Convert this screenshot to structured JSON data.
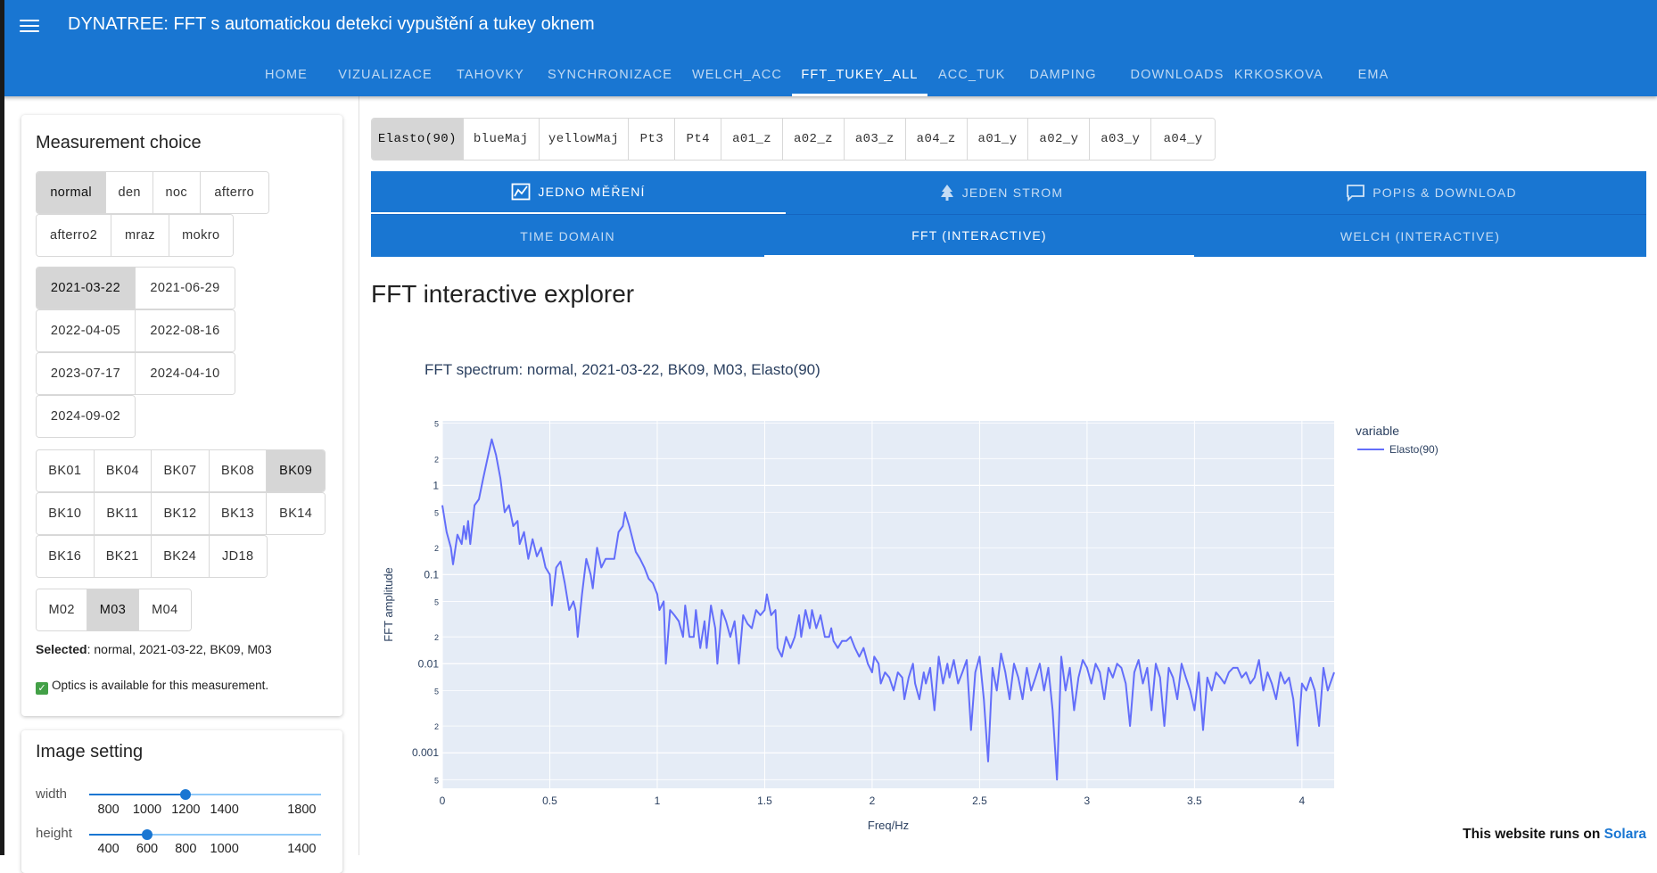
{
  "app_bar": {
    "title": "DYNATREE: FFT s automatickou detekci vypuštění a tukey oknem",
    "nav": [
      {
        "label": "HOME"
      },
      {
        "label": "VIZUALIZACE"
      },
      {
        "label": "TAHOVKY"
      },
      {
        "label": "SYNCHRONIZACE"
      },
      {
        "label": "WELCH_ACC"
      },
      {
        "label": "FFT_TUKEY_ALL",
        "active": true
      },
      {
        "label": "ACC_TUK"
      },
      {
        "label": "DAMPING"
      },
      {
        "label": "DOWNLOADS"
      },
      {
        "label": "KRKOSKOVA"
      },
      {
        "label": "EMA"
      }
    ]
  },
  "sidebar": {
    "measurement_title": "Measurement choice",
    "day_types": [
      {
        "label": "normal",
        "selected": true
      },
      {
        "label": "den"
      },
      {
        "label": "noc"
      },
      {
        "label": "afterro"
      },
      {
        "label": "afterro2"
      },
      {
        "label": "mraz"
      },
      {
        "label": "mokro"
      }
    ],
    "dates": [
      {
        "label": "2021-03-22",
        "selected": true
      },
      {
        "label": "2021-06-29"
      },
      {
        "label": "2022-04-05"
      },
      {
        "label": "2022-08-16"
      },
      {
        "label": "2023-07-17"
      },
      {
        "label": "2024-04-10"
      },
      {
        "label": "2024-09-02"
      }
    ],
    "trees": [
      {
        "label": "BK01"
      },
      {
        "label": "BK04"
      },
      {
        "label": "BK07"
      },
      {
        "label": "BK08"
      },
      {
        "label": "BK09",
        "selected": true
      },
      {
        "label": "BK10"
      },
      {
        "label": "BK11"
      },
      {
        "label": "BK12"
      },
      {
        "label": "BK13"
      },
      {
        "label": "BK14"
      },
      {
        "label": "BK16"
      },
      {
        "label": "BK21"
      },
      {
        "label": "BK24"
      },
      {
        "label": "JD18"
      }
    ],
    "measurements": [
      {
        "label": "M02"
      },
      {
        "label": "M03",
        "selected": true
      },
      {
        "label": "M04"
      }
    ],
    "selected_label": "Selected",
    "selected_value": ": normal, 2021-03-22, BK09, M03",
    "optics_text": "Optics is available for this measurement.",
    "image_title": "Image setting",
    "width": {
      "label": "width",
      "value": 1200,
      "min": 700,
      "max": 1900,
      "ticks": [
        "800",
        "1000",
        "1200",
        "1400",
        "1800"
      ]
    },
    "height": {
      "label": "height",
      "value": 600,
      "min": 300,
      "max": 1500,
      "ticks": [
        "400",
        "600",
        "800",
        "1000",
        "1400"
      ]
    }
  },
  "probes": [
    {
      "label": "Elasto(90)",
      "selected": true
    },
    {
      "label": "blueMaj"
    },
    {
      "label": "yellowMaj"
    },
    {
      "label": "Pt3"
    },
    {
      "label": "Pt4"
    },
    {
      "label": "a01_z"
    },
    {
      "label": "a02_z"
    },
    {
      "label": "a03_z"
    },
    {
      "label": "a04_z"
    },
    {
      "label": "a01_y"
    },
    {
      "label": "a02_y"
    },
    {
      "label": "a03_y"
    },
    {
      "label": "a04_y"
    }
  ],
  "main_tabs": [
    {
      "label": "JEDNO MĚŘENÍ",
      "icon": "chart-line-icon",
      "active": true
    },
    {
      "label": "JEDEN STROM",
      "icon": "tree-icon"
    },
    {
      "label": "POPIS & DOWNLOAD",
      "icon": "comment-icon"
    }
  ],
  "sub_tabs": [
    {
      "label": "TIME DOMAIN"
    },
    {
      "label": "FFT (INTERACTIVE)",
      "active": true
    },
    {
      "label": "WELCH (INTERACTIVE)"
    }
  ],
  "content": {
    "heading": "FFT interactive explorer"
  },
  "chart_data": {
    "type": "line",
    "title": "FFT spectrum: normal, 2021-03-22, BK09, M03, Elasto(90)",
    "xlabel": "Freq/Hz",
    "ylabel": "FFT amplitude",
    "xlim": [
      0,
      4.15
    ],
    "ylim": [
      0.0004,
      5.3
    ],
    "yscale": "log",
    "grid": true,
    "legend_title": "variable",
    "legend_position": "right",
    "x_ticks": [
      "0",
      "0.5",
      "1",
      "1.5",
      "2",
      "2.5",
      "3",
      "3.5",
      "4"
    ],
    "y_tick_labels": [
      {
        "v": 5,
        "t": "5"
      },
      {
        "v": 2,
        "t": "2"
      },
      {
        "v": 1,
        "t": "1"
      },
      {
        "v": 0.5,
        "t": "5"
      },
      {
        "v": 0.2,
        "t": "2"
      },
      {
        "v": 0.1,
        "t": "0.1"
      },
      {
        "v": 0.05,
        "t": "5"
      },
      {
        "v": 0.02,
        "t": "2"
      },
      {
        "v": 0.01,
        "t": "0.01"
      },
      {
        "v": 0.005,
        "t": "5"
      },
      {
        "v": 0.002,
        "t": "2"
      },
      {
        "v": 0.001,
        "t": "0.001"
      },
      {
        "v": 0.0005,
        "t": "5"
      }
    ],
    "series": [
      {
        "name": "Elasto(90)",
        "color": "#636efa",
        "points": [
          [
            0,
            0.6
          ],
          [
            0.02,
            0.3
          ],
          [
            0.04,
            0.2
          ],
          [
            0.05,
            0.13
          ],
          [
            0.07,
            0.28
          ],
          [
            0.09,
            0.22
          ],
          [
            0.1,
            0.35
          ],
          [
            0.11,
            0.25
          ],
          [
            0.12,
            0.4
          ],
          [
            0.13,
            0.22
          ],
          [
            0.15,
            0.6
          ],
          [
            0.17,
            0.7
          ],
          [
            0.19,
            1.2
          ],
          [
            0.21,
            2.0
          ],
          [
            0.23,
            3.3
          ],
          [
            0.25,
            2.2
          ],
          [
            0.27,
            1.2
          ],
          [
            0.29,
            0.5
          ],
          [
            0.31,
            0.6
          ],
          [
            0.33,
            0.35
          ],
          [
            0.35,
            0.4
          ],
          [
            0.36,
            0.22
          ],
          [
            0.38,
            0.3
          ],
          [
            0.4,
            0.15
          ],
          [
            0.42,
            0.25
          ],
          [
            0.44,
            0.16
          ],
          [
            0.46,
            0.2
          ],
          [
            0.48,
            0.12
          ],
          [
            0.5,
            0.1
          ],
          [
            0.51,
            0.045
          ],
          [
            0.53,
            0.12
          ],
          [
            0.55,
            0.14
          ],
          [
            0.57,
            0.08
          ],
          [
            0.59,
            0.04
          ],
          [
            0.61,
            0.05
          ],
          [
            0.62,
            0.04
          ],
          [
            0.63,
            0.02
          ],
          [
            0.65,
            0.06
          ],
          [
            0.67,
            0.15
          ],
          [
            0.69,
            0.1
          ],
          [
            0.7,
            0.07
          ],
          [
            0.72,
            0.2
          ],
          [
            0.74,
            0.12
          ],
          [
            0.76,
            0.15
          ],
          [
            0.78,
            0.15
          ],
          [
            0.8,
            0.15
          ],
          [
            0.82,
            0.3
          ],
          [
            0.84,
            0.35
          ],
          [
            0.85,
            0.5
          ],
          [
            0.87,
            0.35
          ],
          [
            0.9,
            0.18
          ],
          [
            0.92,
            0.15
          ],
          [
            0.94,
            0.12
          ],
          [
            0.96,
            0.09
          ],
          [
            0.98,
            0.08
          ],
          [
            1.0,
            0.06
          ],
          [
            1.01,
            0.04
          ],
          [
            1.03,
            0.05
          ],
          [
            1.04,
            0.01
          ],
          [
            1.06,
            0.04
          ],
          [
            1.08,
            0.035
          ],
          [
            1.1,
            0.03
          ],
          [
            1.12,
            0.02
          ],
          [
            1.13,
            0.045
          ],
          [
            1.15,
            0.02
          ],
          [
            1.17,
            0.02
          ],
          [
            1.18,
            0.04
          ],
          [
            1.2,
            0.015
          ],
          [
            1.22,
            0.03
          ],
          [
            1.23,
            0.015
          ],
          [
            1.25,
            0.045
          ],
          [
            1.27,
            0.025
          ],
          [
            1.28,
            0.01
          ],
          [
            1.3,
            0.04
          ],
          [
            1.32,
            0.03
          ],
          [
            1.34,
            0.02
          ],
          [
            1.36,
            0.03
          ],
          [
            1.38,
            0.01
          ],
          [
            1.4,
            0.035
          ],
          [
            1.42,
            0.028
          ],
          [
            1.44,
            0.025
          ],
          [
            1.46,
            0.04
          ],
          [
            1.48,
            0.035
          ],
          [
            1.5,
            0.04
          ],
          [
            1.51,
            0.06
          ],
          [
            1.53,
            0.035
          ],
          [
            1.55,
            0.04
          ],
          [
            1.56,
            0.015
          ],
          [
            1.58,
            0.012
          ],
          [
            1.6,
            0.02
          ],
          [
            1.62,
            0.015
          ],
          [
            1.64,
            0.02
          ],
          [
            1.66,
            0.035
          ],
          [
            1.67,
            0.02
          ],
          [
            1.69,
            0.04
          ],
          [
            1.71,
            0.025
          ],
          [
            1.72,
            0.04
          ],
          [
            1.74,
            0.025
          ],
          [
            1.76,
            0.035
          ],
          [
            1.78,
            0.02
          ],
          [
            1.8,
            0.02
          ],
          [
            1.81,
            0.025
          ],
          [
            1.82,
            0.018
          ],
          [
            1.84,
            0.015
          ],
          [
            1.86,
            0.018
          ],
          [
            1.88,
            0.018
          ],
          [
            1.9,
            0.02
          ],
          [
            1.92,
            0.015
          ],
          [
            1.94,
            0.012
          ],
          [
            1.96,
            0.015
          ],
          [
            1.98,
            0.01
          ],
          [
            2.0,
            0.008
          ],
          [
            2.01,
            0.012
          ],
          [
            2.03,
            0.01
          ],
          [
            2.04,
            0.006
          ],
          [
            2.06,
            0.008
          ],
          [
            2.08,
            0.007
          ],
          [
            2.1,
            0.005
          ],
          [
            2.12,
            0.008
          ],
          [
            2.14,
            0.007
          ],
          [
            2.15,
            0.004
          ],
          [
            2.17,
            0.007
          ],
          [
            2.19,
            0.01
          ],
          [
            2.2,
            0.006
          ],
          [
            2.22,
            0.004
          ],
          [
            2.24,
            0.008
          ],
          [
            2.25,
            0.006
          ],
          [
            2.27,
            0.009
          ],
          [
            2.29,
            0.003
          ],
          [
            2.31,
            0.012
          ],
          [
            2.33,
            0.006
          ],
          [
            2.35,
            0.01
          ],
          [
            2.36,
            0.007
          ],
          [
            2.38,
            0.011
          ],
          [
            2.4,
            0.006
          ],
          [
            2.42,
            0.008
          ],
          [
            2.44,
            0.011
          ],
          [
            2.46,
            0.0018
          ],
          [
            2.48,
            0.008
          ],
          [
            2.5,
            0.012
          ],
          [
            2.52,
            0.004
          ],
          [
            2.54,
            0.0008
          ],
          [
            2.56,
            0.009
          ],
          [
            2.58,
            0.005
          ],
          [
            2.6,
            0.013
          ],
          [
            2.62,
            0.008
          ],
          [
            2.64,
            0.004
          ],
          [
            2.66,
            0.01
          ],
          [
            2.68,
            0.007
          ],
          [
            2.7,
            0.004
          ],
          [
            2.72,
            0.009
          ],
          [
            2.74,
            0.005
          ],
          [
            2.76,
            0.007
          ],
          [
            2.78,
            0.01
          ],
          [
            2.8,
            0.005
          ],
          [
            2.82,
            0.009
          ],
          [
            2.84,
            0.003
          ],
          [
            2.86,
            0.0005
          ],
          [
            2.88,
            0.012
          ],
          [
            2.9,
            0.005
          ],
          [
            2.92,
            0.009
          ],
          [
            2.94,
            0.003
          ],
          [
            2.96,
            0.007
          ],
          [
            2.98,
            0.011
          ],
          [
            3.0,
            0.009
          ],
          [
            3.02,
            0.006
          ],
          [
            3.04,
            0.01
          ],
          [
            3.06,
            0.008
          ],
          [
            3.08,
            0.004
          ],
          [
            3.1,
            0.009
          ],
          [
            3.12,
            0.007
          ],
          [
            3.14,
            0.01
          ],
          [
            3.16,
            0.009
          ],
          [
            3.18,
            0.006
          ],
          [
            3.2,
            0.002
          ],
          [
            3.22,
            0.008
          ],
          [
            3.24,
            0.011
          ],
          [
            3.26,
            0.006
          ],
          [
            3.28,
            0.009
          ],
          [
            3.3,
            0.003
          ],
          [
            3.32,
            0.01
          ],
          [
            3.34,
            0.007
          ],
          [
            3.36,
            0.002
          ],
          [
            3.38,
            0.009
          ],
          [
            3.4,
            0.007
          ],
          [
            3.42,
            0.004
          ],
          [
            3.44,
            0.01
          ],
          [
            3.46,
            0.007
          ],
          [
            3.48,
            0.005
          ],
          [
            3.5,
            0.003
          ],
          [
            3.52,
            0.008
          ],
          [
            3.54,
            0.0018
          ],
          [
            3.56,
            0.007
          ],
          [
            3.58,
            0.005
          ],
          [
            3.6,
            0.008
          ],
          [
            3.62,
            0.007
          ],
          [
            3.64,
            0.006
          ],
          [
            3.66,
            0.008
          ],
          [
            3.68,
            0.009
          ],
          [
            3.7,
            0.009
          ],
          [
            3.72,
            0.007
          ],
          [
            3.74,
            0.008
          ],
          [
            3.76,
            0.006
          ],
          [
            3.78,
            0.007
          ],
          [
            3.8,
            0.011
          ],
          [
            3.82,
            0.005
          ],
          [
            3.84,
            0.008
          ],
          [
            3.86,
            0.006
          ],
          [
            3.88,
            0.004
          ],
          [
            3.9,
            0.008
          ],
          [
            3.92,
            0.006
          ],
          [
            3.94,
            0.007
          ],
          [
            3.96,
            0.004
          ],
          [
            3.98,
            0.0012
          ],
          [
            4.0,
            0.006
          ],
          [
            4.02,
            0.005
          ],
          [
            4.04,
            0.007
          ],
          [
            4.06,
            0.005
          ],
          [
            4.08,
            0.002
          ],
          [
            4.1,
            0.009
          ],
          [
            4.12,
            0.005
          ],
          [
            4.15,
            0.008
          ]
        ]
      }
    ]
  },
  "footer": {
    "text": "This website runs on ",
    "link": "Solara"
  }
}
